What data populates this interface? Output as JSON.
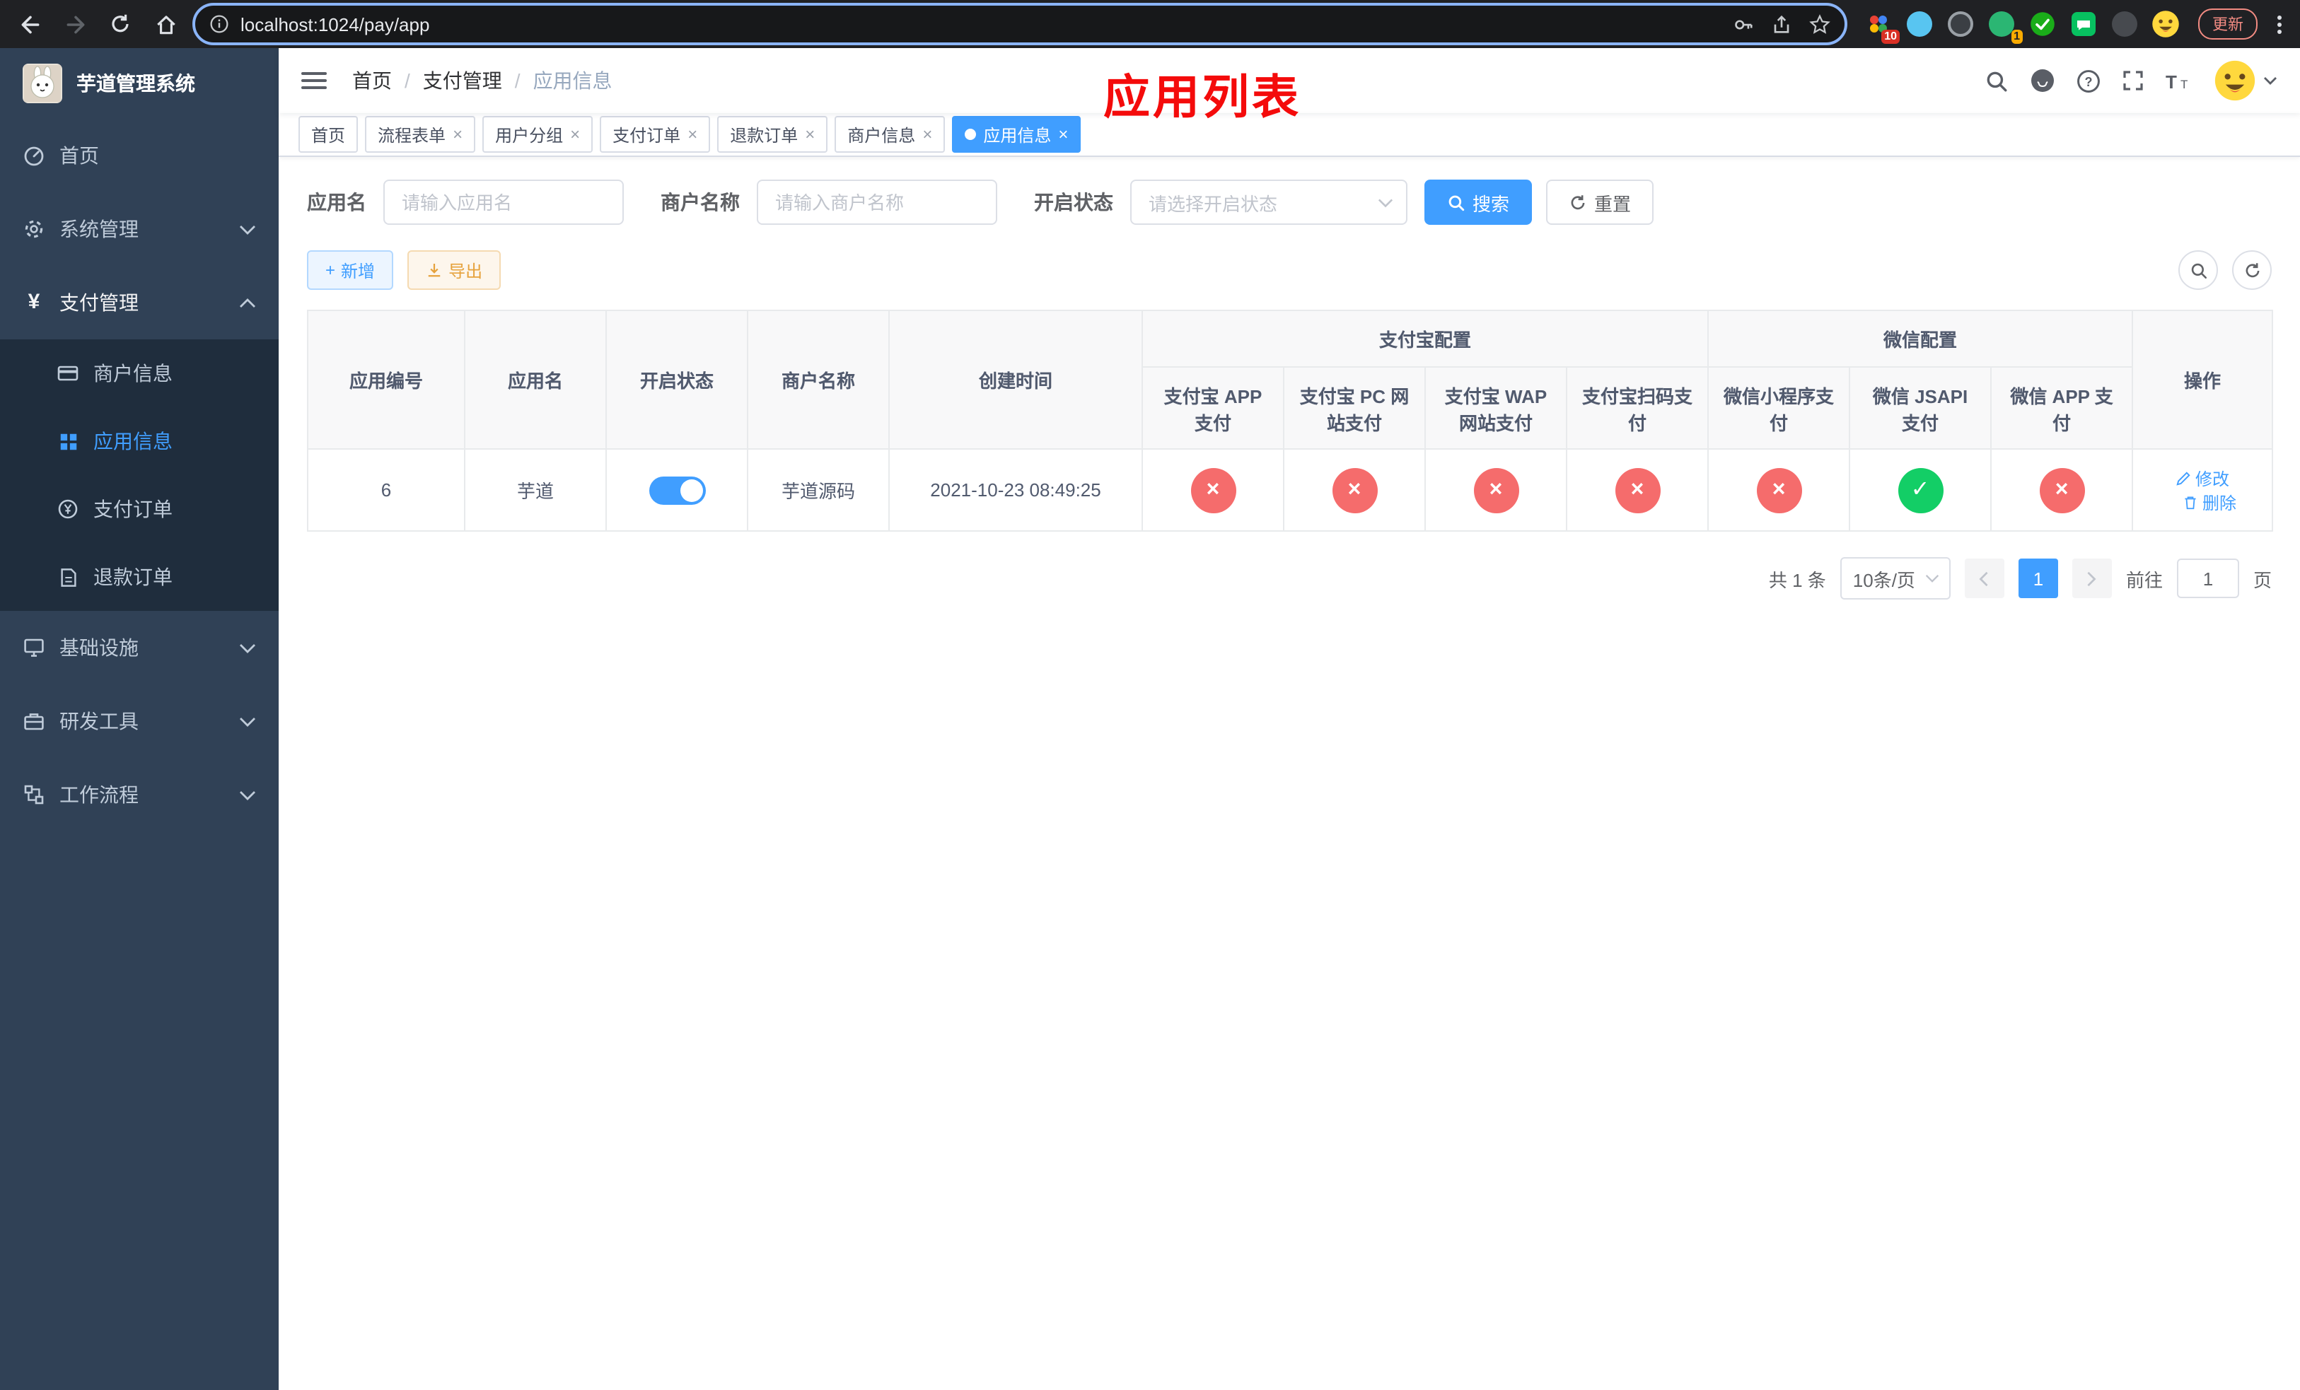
{
  "browser": {
    "url": "localhost:1024/pay/app",
    "update_label": "更新",
    "ext_badges": {
      "first": "10",
      "second": "1"
    }
  },
  "icons": {
    "plus": "+",
    "close": "×",
    "prev": "‹",
    "next": "›"
  },
  "sidebar": {
    "app_title": "芋道管理系统",
    "items": [
      {
        "label": "首页"
      },
      {
        "label": "系统管理"
      },
      {
        "label": "支付管理"
      },
      {
        "label": "基础设施"
      },
      {
        "label": "研发工具"
      },
      {
        "label": "工作流程"
      }
    ],
    "payment_children": [
      {
        "label": "商户信息"
      },
      {
        "label": "应用信息"
      },
      {
        "label": "支付订单"
      },
      {
        "label": "退款订单"
      }
    ]
  },
  "header": {
    "breadcrumb": [
      "首页",
      "支付管理",
      "应用信息"
    ],
    "overlay_title": "应用列表"
  },
  "tabs": [
    {
      "label": "首页"
    },
    {
      "label": "流程表单"
    },
    {
      "label": "用户分组"
    },
    {
      "label": "支付订单"
    },
    {
      "label": "退款订单"
    },
    {
      "label": "商户信息"
    },
    {
      "label": "应用信息"
    }
  ],
  "filters": {
    "app_name_label": "应用名",
    "app_name_placeholder": "请输入应用名",
    "merchant_label": "商户名称",
    "merchant_placeholder": "请输入商户名称",
    "status_label": "开启状态",
    "status_placeholder": "请选择开启状态",
    "search_label": "搜索",
    "reset_label": "重置"
  },
  "toolbar": {
    "add_label": "新增",
    "export_label": "导出"
  },
  "table": {
    "group_alipay": "支付宝配置",
    "group_wechat": "微信配置",
    "col_id": "应用编号",
    "col_name": "应用名",
    "col_status": "开启状态",
    "col_merchant": "商户名称",
    "col_created": "创建时间",
    "col_actions": "操作",
    "alipay_cols": [
      "支付宝 APP 支付",
      "支付宝 PC 网站支付",
      "支付宝 WAP 网站支付",
      "支付宝扫码支付"
    ],
    "wechat_cols": [
      "微信小程序支付",
      "微信 JSAPI 支付",
      "微信 APP 支付"
    ],
    "rows": [
      {
        "id": "6",
        "name": "芋道",
        "enabled": true,
        "merchant": "芋道源码",
        "created": "2021-10-23 08:49:25",
        "alipay_app": false,
        "alipay_pc": false,
        "alipay_wap": false,
        "alipay_qr": false,
        "wechat_mini": false,
        "wechat_jsapi": true,
        "wechat_app": false,
        "edit_label": "修改",
        "delete_label": "删除"
      }
    ]
  },
  "pagination": {
    "total_text": "共 1 条",
    "page_size": "10条/页",
    "current_page": "1",
    "goto_prefix": "前往",
    "goto_value": "1",
    "goto_suffix": "页"
  }
}
